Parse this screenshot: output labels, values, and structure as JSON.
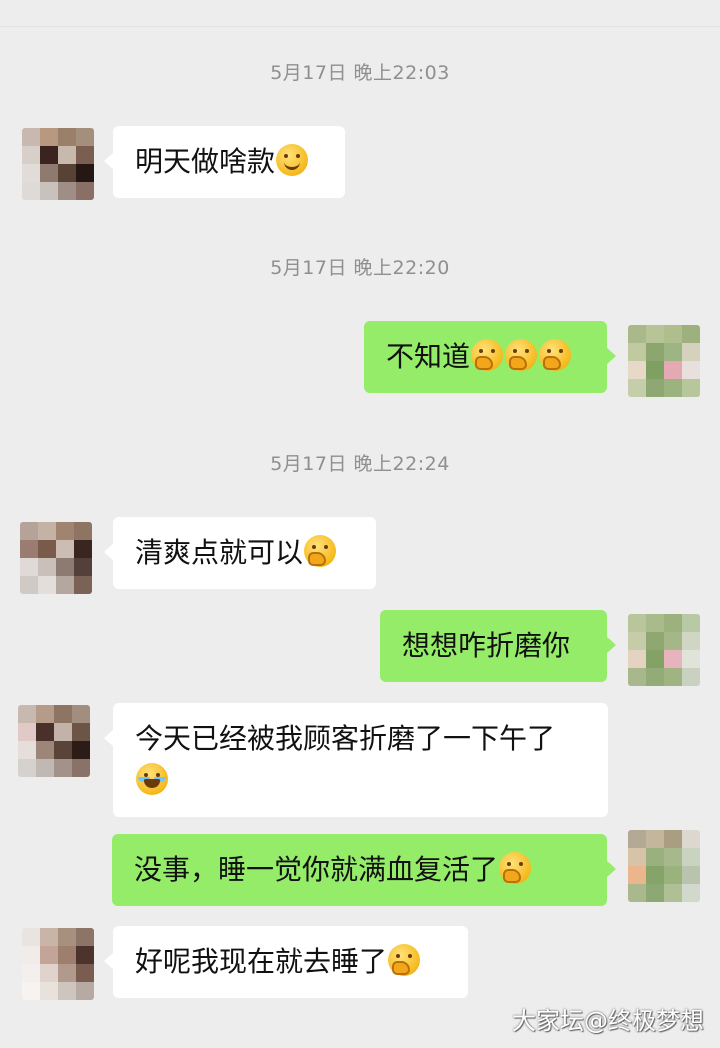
{
  "timestamps": [
    "5月17日 晚上22:03",
    "5月17日 晚上22:20",
    "5月17日 晚上22:24"
  ],
  "messages": [
    {
      "text": "明天做啥款",
      "direction": "in",
      "emoji": "smiling-face-emoji"
    },
    {
      "text": "不知道",
      "direction": "out",
      "emoji": "face-with-hand-over-mouth-emoji x3"
    },
    {
      "text": "清爽点就可以",
      "direction": "in",
      "emoji": "face-with-hand-over-mouth-emoji"
    },
    {
      "text": "想想咋折磨你",
      "direction": "out"
    },
    {
      "text": "今天已经被我顾客折磨了一下午了",
      "direction": "in",
      "emoji": "rolling-on-floor-laughing-emoji"
    },
    {
      "text": "没事，睡一觉你就满血复活了",
      "direction": "out",
      "emoji": "face-with-hand-over-mouth-emoji"
    },
    {
      "text": "好呢我现在就去睡了",
      "direction": "in",
      "emoji": "face-with-hand-over-mouth-emoji"
    }
  ],
  "watermark": "大家坛@终极梦想",
  "colors": {
    "background": "#ededed",
    "bubble_out": "#95ec69",
    "bubble_in": "#ffffff",
    "timestamp": "#8f8f8f"
  }
}
